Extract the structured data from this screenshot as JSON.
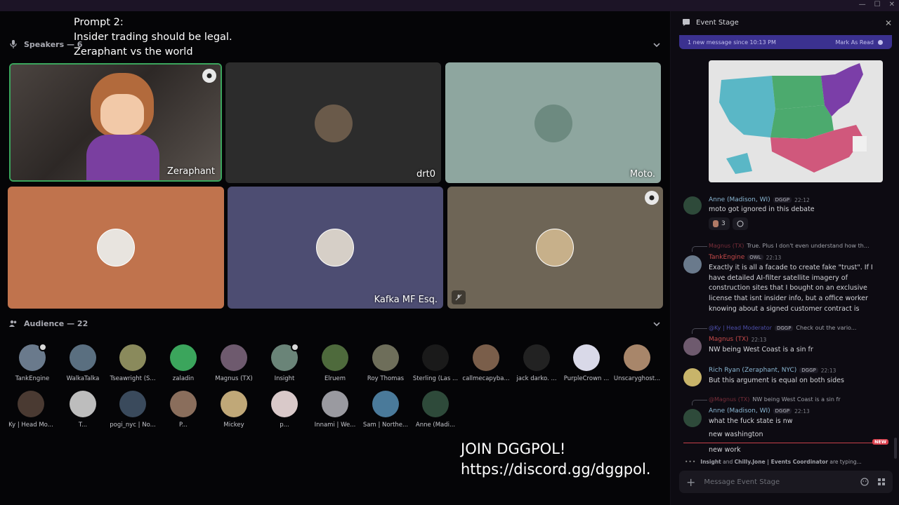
{
  "overlay": {
    "line1": "Prompt 2:",
    "line2": "Insider trading should be legal.",
    "line3": "Zeraphant vs the world"
  },
  "speakers": {
    "label": "Speakers — 6"
  },
  "tiles": [
    {
      "name": "Zeraphant",
      "bg": "#3a3432"
    },
    {
      "name": "drt0",
      "bg": "#2c2c2c"
    },
    {
      "name": "Moto.",
      "bg": "#8ea69f"
    },
    {
      "name": "",
      "bg": "#c0734d"
    },
    {
      "name": "Kafka MF Esq.",
      "bg": "#4d4d72"
    },
    {
      "name": "",
      "bg": "#6e6556"
    }
  ],
  "audience": {
    "label": "Audience — 22",
    "members": [
      {
        "name": "TankEngine",
        "color": "#6a7a8c"
      },
      {
        "name": "WalkaTalka",
        "color": "#5a6f80"
      },
      {
        "name": "Tseawright (S...",
        "color": "#8a8a5c"
      },
      {
        "name": "zaladin",
        "color": "#3ba55c"
      },
      {
        "name": "Magnus (TX)",
        "color": "#6e5a6e"
      },
      {
        "name": "Insight",
        "color": "#6a8478"
      },
      {
        "name": "Elruem",
        "color": "#4e6a3c"
      },
      {
        "name": "Roy Thomas",
        "color": "#6e6e5a"
      },
      {
        "name": "Sterling (Las ...",
        "color": "#1a1a1a"
      },
      {
        "name": "callmecapyba...",
        "color": "#7a5e4a"
      },
      {
        "name": "jack darko. ...",
        "color": "#222222"
      },
      {
        "name": "PurpleCrown ...",
        "color": "#d9d9e8"
      },
      {
        "name": "Unscaryghost...",
        "color": "#a8866a"
      },
      {
        "name": "Ky | Head Mo...",
        "color": "#4a3a32"
      },
      {
        "name": "T...",
        "color": "#bdbdbd"
      },
      {
        "name": "pogi_nyc | No...",
        "color": "#3a4a5c"
      },
      {
        "name": "P...",
        "color": "#8a6e5c"
      },
      {
        "name": "Mickey",
        "color": "#c0a878"
      },
      {
        "name": "p...",
        "color": "#d9c9c9"
      },
      {
        "name": "Innami | We...",
        "color": "#9a9aa0"
      },
      {
        "name": "Sam | Northe...",
        "color": "#4a7a9a"
      },
      {
        "name": "Anne (Madi...",
        "color": "#2e4a3a"
      }
    ]
  },
  "banner": {
    "line1": "JOIN DGGPOL!",
    "line2": "https://discord.gg/dggpol."
  },
  "chat": {
    "title": "Event Stage",
    "new_messages": "1 new message since 10:13 PM",
    "mark_read": "Mark As Read",
    "messages": [
      {
        "author": "Anne (Madison, WI)",
        "tag": "DGGP",
        "time": "22:12",
        "text": "moto got ignored in this debate",
        "author_color": "#8bb8d4",
        "reaction_count": "3"
      },
      {
        "reply_to": "Magnus (TX)",
        "reply_text": "True. Plus I don't even understand how th...",
        "author": "TankEngine",
        "tag": "OWL",
        "time": "22:13",
        "author_color": "#c64a4a",
        "text": "Exactly it is all a facade to create fake \"trust\". If I have detailed AI-filter satellite imagery of construction sites that I bought on an exclusive license that isnt insider info, but a office worker knowing about a signed customer contract is"
      },
      {
        "reply_to": "@Ky | Head Moderator",
        "reply_tag": "DGGP",
        "reply_text": "Check out the vario...",
        "author": "Magnus (TX)",
        "time": "22:13",
        "author_color": "#c64a4a",
        "text": "NW being West Coast is a sin fr"
      },
      {
        "author": "Rich Ryan (Zeraphant, NYC)",
        "tag": "DGGP",
        "time": "22:13",
        "author_color": "#8bb8d4",
        "text": "But this argument is equal on both sides"
      },
      {
        "reply_to": "@Magnus (TX)",
        "reply_text": "NW being West Coast is a sin fr",
        "author": "Anne (Madison, WI)",
        "tag": "DGGP",
        "time": "22:13",
        "author_color": "#8bb8d4",
        "text": "what the fuck state is nw"
      },
      {
        "text": "new washington"
      },
      {
        "text": "new work"
      }
    ],
    "new_label": "NEW",
    "typing": {
      "user1": "Insight",
      "and": "and",
      "user2": "Chilly.Jone | Events Coordinator",
      "suffix": "are typing..."
    },
    "composer_placeholder": "Message Event Stage"
  }
}
